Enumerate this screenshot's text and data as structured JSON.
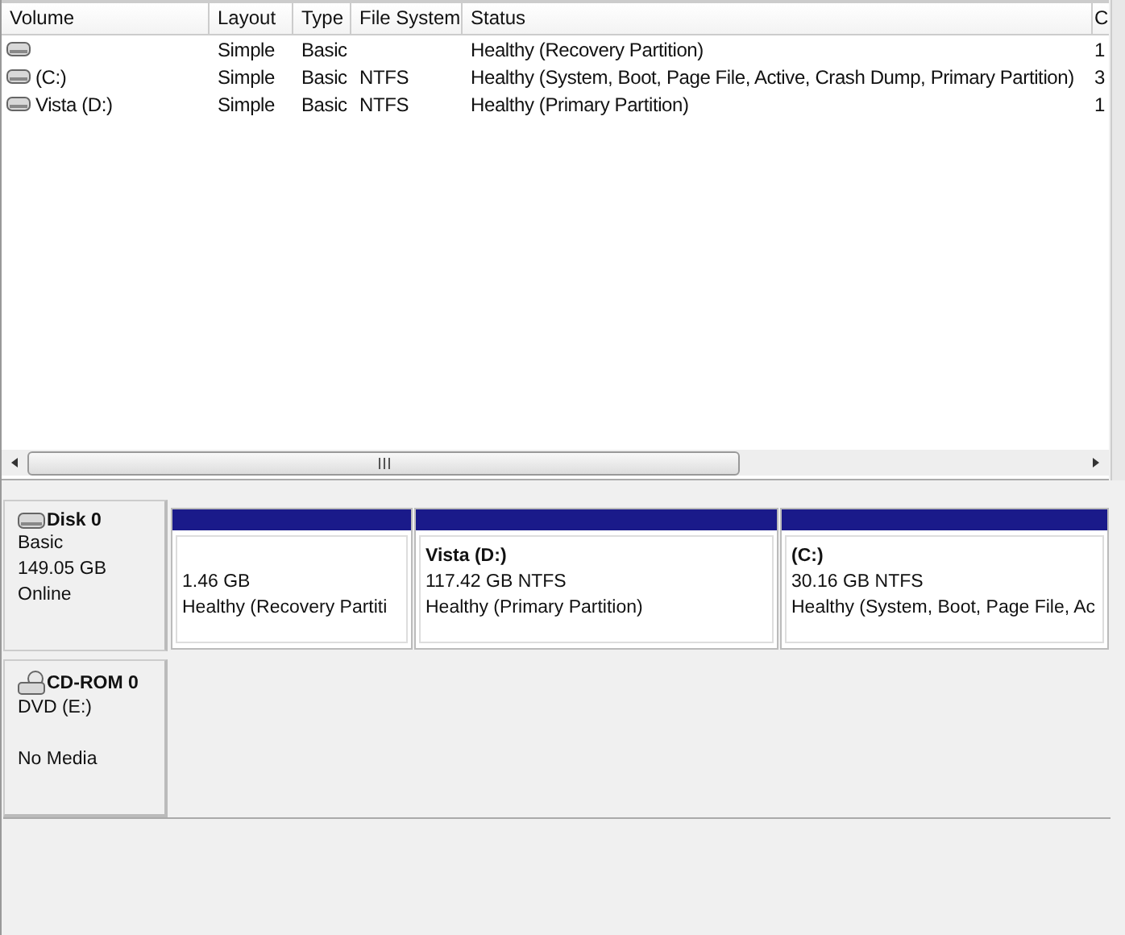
{
  "volume_table": {
    "columns": [
      "Volume",
      "Layout",
      "Type",
      "File System",
      "Status",
      "C"
    ],
    "rows": [
      {
        "volume": "",
        "layout": "Simple",
        "type": "Basic",
        "file_system": "",
        "status": "Healthy (Recovery Partition)",
        "column_6": "1"
      },
      {
        "volume": "(C:)",
        "layout": "Simple",
        "type": "Basic",
        "file_system": "NTFS",
        "status": "Healthy (System, Boot, Page File, Active, Crash Dump, Primary Partition)",
        "column_6": "3"
      },
      {
        "volume": "Vista (D:)",
        "layout": "Simple",
        "type": "Basic",
        "file_system": "NTFS",
        "status": "Healthy (Primary Partition)",
        "column_6": "1"
      }
    ]
  },
  "disks": [
    {
      "kind": "disk",
      "name": "Disk 0",
      "lines": [
        "Basic",
        "149.05 GB",
        "Online"
      ],
      "partitions": [
        {
          "size": "1.46 GB",
          "status": "Healthy (Recovery Partiti"
        },
        {
          "name": "Vista  (D:)",
          "size": "117.42 GB NTFS",
          "status": "Healthy (Primary Partition)"
        },
        {
          "name": "(C:)",
          "size": "30.16 GB NTFS",
          "status": "Healthy (System, Boot, Page File, Ac"
        }
      ]
    },
    {
      "kind": "cdrom",
      "name": "CD-ROM 0",
      "lines": [
        "DVD (E:)",
        "No Media"
      ]
    }
  ]
}
